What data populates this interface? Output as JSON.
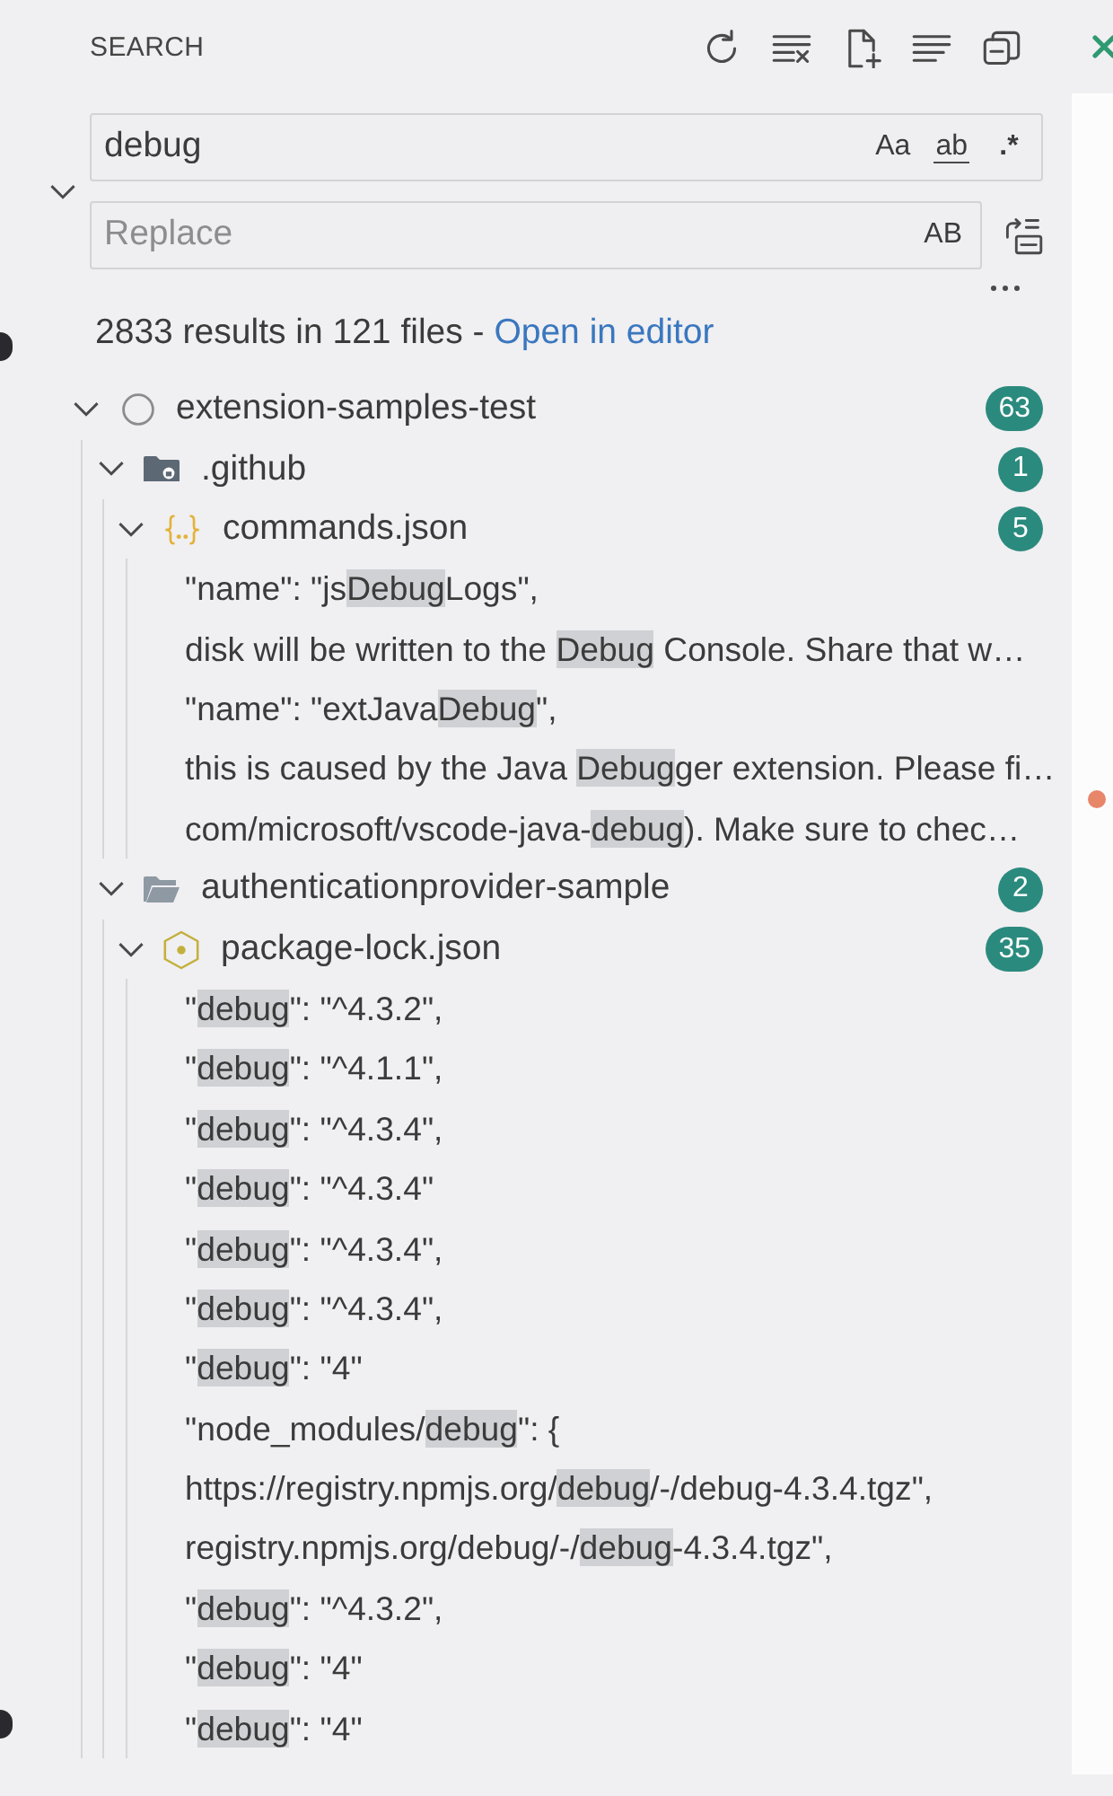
{
  "header": {
    "title": "SEARCH"
  },
  "search": {
    "value": "debug",
    "toggles": [
      {
        "kind": "case",
        "label": "Aa",
        "on": false
      },
      {
        "kind": "word",
        "label": "ab",
        "on": false
      },
      {
        "kind": "regex",
        "label": ".*",
        "on": false
      }
    ]
  },
  "replace": {
    "expanded": true,
    "placeholder": "Replace",
    "toggles": [
      {
        "label": "AB",
        "on": false
      }
    ]
  },
  "summary": {
    "text": "2833 results in 121 files - ",
    "link": "Open in editor"
  },
  "tree": [
    {
      "kind": "workspace",
      "label": "extension-samples-test",
      "count": "63",
      "expanded": true,
      "children": [
        {
          "kind": "special-folder",
          "label": ".github",
          "count": "1",
          "expanded": true,
          "children": [
            {
              "kind": "json-file",
              "label": "commands.json",
              "count": "5",
              "expanded": true,
              "matches": [
                {
                  "before": "\"name\": \"js",
                  "match": "Debug",
                  "after": "Logs\","
                },
                {
                  "before": "disk will be written to the ",
                  "match": "Debug",
                  "after": " Console. Share that w…"
                },
                {
                  "before": "\"name\": \"extJava",
                  "match": "Debug",
                  "after": "\","
                },
                {
                  "before": "this is caused by the Java ",
                  "match": "Debug",
                  "after": "ger extension. Please fi…"
                },
                {
                  "before": "com/microsoft/vscode-java-",
                  "match": "debug",
                  "after": "). Make sure to chec…"
                }
              ]
            }
          ]
        },
        {
          "kind": "folder",
          "label": "authenticationprovider-sample",
          "count": "2",
          "expanded": true,
          "children": [
            {
              "kind": "js-file",
              "label": "package-lock.json",
              "count": "35",
              "expanded": true,
              "matches": [
                {
                  "before": "\"",
                  "match": "debug",
                  "after": "\": \"^4.3.2\","
                },
                {
                  "before": "\"",
                  "match": "debug",
                  "after": "\": \"^4.1.1\","
                },
                {
                  "before": "\"",
                  "match": "debug",
                  "after": "\": \"^4.3.4\","
                },
                {
                  "before": "\"",
                  "match": "debug",
                  "after": "\": \"^4.3.4\""
                },
                {
                  "before": "\"",
                  "match": "debug",
                  "after": "\": \"^4.3.4\","
                },
                {
                  "before": "\"",
                  "match": "debug",
                  "after": "\": \"^4.3.4\","
                },
                {
                  "before": "\"",
                  "match": "debug",
                  "after": "\": \"4\""
                },
                {
                  "before": "\"node_modules/",
                  "match": "debug",
                  "after": "\": {"
                },
                {
                  "before": "https://registry.npmjs.org/",
                  "match": "debug",
                  "after": "/-/debug-4.3.4.tgz\","
                },
                {
                  "before": "registry.npmjs.org/debug/-/",
                  "match": "debug",
                  "after": "-4.3.4.tgz\","
                },
                {
                  "before": "\"",
                  "match": "debug",
                  "after": "\": \"^4.3.2\","
                },
                {
                  "before": "\"",
                  "match": "debug",
                  "after": "\": \"4\""
                },
                {
                  "before": "\"",
                  "match": "debug",
                  "after": "\": \"4\""
                }
              ]
            }
          ]
        }
      ]
    }
  ]
}
